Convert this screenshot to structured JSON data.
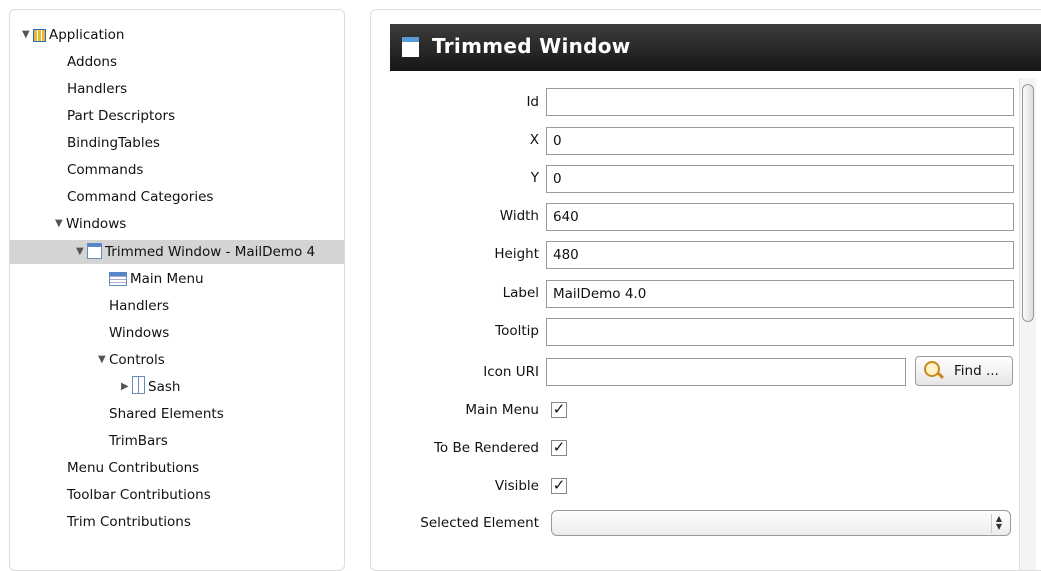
{
  "tree": {
    "root": "Application",
    "items": [
      {
        "label": "Addons"
      },
      {
        "label": "Handlers"
      },
      {
        "label": "Part Descriptors"
      },
      {
        "label": "BindingTables"
      },
      {
        "label": "Commands"
      },
      {
        "label": "Command Categories"
      },
      {
        "label": "Windows"
      },
      {
        "label": "Trimmed Window - MailDemo 4"
      },
      {
        "label": "Main Menu"
      },
      {
        "label": "Handlers"
      },
      {
        "label": "Windows"
      },
      {
        "label": "Controls"
      },
      {
        "label": "Sash"
      },
      {
        "label": "Shared Elements"
      },
      {
        "label": "TrimBars"
      },
      {
        "label": "Menu Contributions"
      },
      {
        "label": "Toolbar Contributions"
      },
      {
        "label": "Trim Contributions"
      }
    ]
  },
  "detail": {
    "title": "Trimmed Window",
    "fields": [
      {
        "label": "Id",
        "value": ""
      },
      {
        "label": "X",
        "value": "0"
      },
      {
        "label": "Y",
        "value": "0"
      },
      {
        "label": "Width",
        "value": "640"
      },
      {
        "label": "Height",
        "value": "480"
      },
      {
        "label": "Label",
        "value": "MailDemo 4.0"
      },
      {
        "label": "Tooltip",
        "value": ""
      },
      {
        "label": "Icon URI",
        "value": ""
      }
    ],
    "find_label": "Find ...",
    "checks": [
      {
        "label": "Main Menu",
        "checked": true
      },
      {
        "label": "To Be Rendered",
        "checked": true
      },
      {
        "label": "Visible",
        "checked": true
      }
    ],
    "selected_element_label": "Selected Element",
    "selected_element_value": ""
  },
  "icons": {
    "application": "application-icon",
    "window": "window-icon",
    "menu": "menu-icon",
    "sash": "sash-icon",
    "find": "magnifier-icon"
  },
  "colors": {
    "header_bg": "#1e1e1e",
    "selection_bg": "#d4d4d4"
  }
}
